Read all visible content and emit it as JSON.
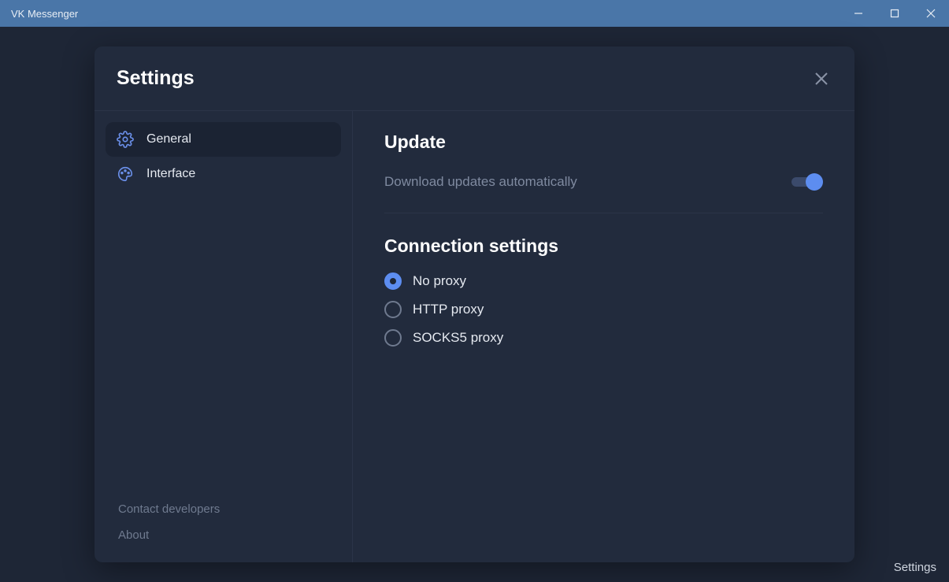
{
  "window": {
    "title": "VK Messenger"
  },
  "dialog": {
    "title": "Settings"
  },
  "sidebar": {
    "items": [
      {
        "label": "General",
        "active": true
      },
      {
        "label": "Interface",
        "active": false
      }
    ],
    "footer": {
      "contact": "Contact developers",
      "about": "About"
    }
  },
  "content": {
    "update": {
      "title": "Update",
      "auto_label": "Download updates automatically",
      "auto_enabled": true
    },
    "connection": {
      "title": "Connection settings",
      "options": [
        {
          "label": "No proxy",
          "selected": true
        },
        {
          "label": "HTTP proxy",
          "selected": false
        },
        {
          "label": "SOCKS5 proxy",
          "selected": false
        }
      ]
    }
  },
  "statusbar": {
    "label": "Settings"
  }
}
